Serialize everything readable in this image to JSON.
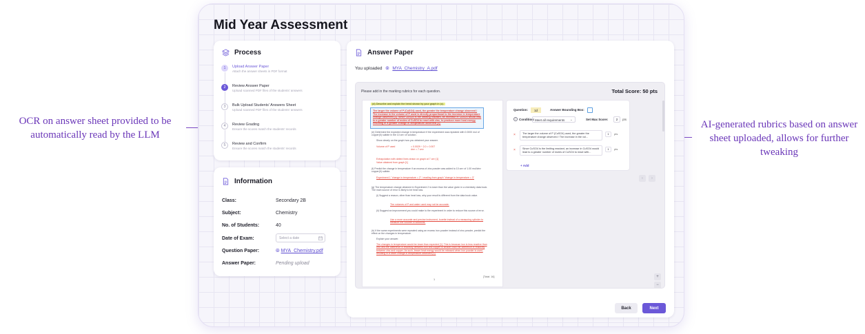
{
  "page_title": "Mid Year Assessment",
  "process": {
    "title": "Process",
    "steps": [
      {
        "num": "1",
        "title": "Upload Answer Paper",
        "subtitle": "Attach the answer sheets in PDF format"
      },
      {
        "num": "2",
        "title": "Review Answer Paper",
        "subtitle": "Upload scanned PDF files of the students' answers"
      },
      {
        "num": "3",
        "title": "Bulk Upload Students' Answers Sheet",
        "subtitle": "Upload scanned PDF files of the students' answers"
      },
      {
        "num": "4",
        "title": "Review Grading",
        "subtitle": "Ensure the scores match the students' records"
      },
      {
        "num": "5",
        "title": "Review and Confirm",
        "subtitle": "Ensure the scores match the students' records"
      }
    ]
  },
  "information": {
    "title": "Information",
    "class_label": "Class:",
    "class_value": "Secondary 2B",
    "subject_label": "Subject:",
    "subject_value": "Chemistry",
    "students_label": "No. of Students:",
    "students_value": "40",
    "date_label": "Date of Exam:",
    "date_placeholder": "Select a date",
    "question_label": "Question Paper:",
    "question_value": "MYA_Chemistry.pdf",
    "answer_label": "Answer Paper:",
    "answer_value": "Pending upload"
  },
  "answer_paper": {
    "title": "Answer Paper",
    "uploaded_prefix": "You uploaded",
    "uploaded_file": "MYA_Chemistry_A.pdf",
    "instruction": "Please add in the marking rubrics for each question.",
    "total_score": "Total Score: 50 pts",
    "paper": {
      "tag": "(d)  Describe and explain the trend shown by your graph in (c).",
      "highlight": "The larger the volume of P (CuSO4) used, the greater the temperature change observed / The increase in the volume of P used is directly proportional to the increase in temperature change observed [1]. Since CuSO4 is the limiting reactant, an increase in CuSO4 would lead to a greater number of moles of CuSO4 to react with zinc, to produce more heat energy, resulting in a greater change in temperature observed [1].",
      "e_text": "(e)  Determine the expected change in temperature if the experiment was repeated with 0.0000 mol of copper(II) sulfate in the 10 cm³ of solution.",
      "e_show": "Show clearly on the graph how you obtained your answer.",
      "e_vol": "Volume of P used",
      "e_calc": "= 0.0029 ÷ 2.0  = 0.007 dm³  = 7 cm³",
      "e_extra": "Extrapolation with dotted lines drawn on graph at 7 cm³ [1]",
      "e_value": "Value obtained from graph [1]",
      "f_text": "(f)  Predict the change in temperature if an excess of zinc powder was added to 10 cm³ of 1.00 mol/dm³ copper(II) sulfate.",
      "f_answer": "Experiment 1 \"change in temperature = 2\" / reading from graph \"change in temperature = 3\"",
      "g_text": "(g)  The temperature change obtained in Experiment 2 is lower than the value given in a chemistry data book. The main source of error is likely to be heat loss.",
      "g_i": "(i)  Suggest a reason, other than heat loss, why your result is different from the data book value.",
      "g_i_ans": "The volumes of P and water used may not be accurate.",
      "g_ii": "(ii)  Suggest an improvement you could make to the experiment in order to reduce this source of error.",
      "g_ii_ans": "Use a more accurate and precise instrument, burette instead of a measuring cylinder to measure the volume of solutions.",
      "h_text": "(h)  If the same experiments were repeated using an excess iron powder instead of zinc powder, predict the effect on the changes in temperature.",
      "h_explain": "Explain your answer.",
      "h_answer": "The changes in temperature would be lower than expected [1]. This is because iron is less reactive than zinc and the difference in reactivity between iron and copper is smaller than the difference in reactivity between zinc and copper. As such, lesser heat energy would be released when iron powder is used, resulting in a lower change in temperature observed [1].",
      "page_num": "1",
      "total_mark": "[Total: 16]"
    },
    "rubric": {
      "question_label": "Question:",
      "question_value": "1d",
      "bbox_label": "Answer Bounding Box:",
      "condition_label": "Condition:",
      "condition_value": "Meet all requirements",
      "max_label": "Set Max Score:",
      "max_value": "2",
      "pts": "pts",
      "criteria": [
        {
          "text": "The larger the volume of P (CuSO4) used, the greater the temperature change observed / The increase in the vol...",
          "score": "1",
          "pts": "pts"
        },
        {
          "text": "Since CuSO4 is the limiting reactant, an increase in CuSO4 would lead to a greater number of moles of CuSO4 to react with...",
          "score": "1",
          "pts": "pts"
        }
      ],
      "add_label": "+ Add"
    },
    "back_label": "Back",
    "next_label": "Next"
  },
  "callouts": {
    "left": "OCR on answer sheet provided to be automatically read by the LLM",
    "right": "AI-generated rubrics based on answer sheet uploaded, allows for further tweaking"
  },
  "colors": {
    "accent": "#6b58d8",
    "callout": "#6a36b8",
    "answer_red": "#e2473c"
  },
  "icons": {
    "process": "layers-icon",
    "information": "document-icon",
    "answer_paper": "document-icon",
    "file": "paperclip-icon",
    "calendar": "calendar-icon",
    "bbox": "bounding-box-icon",
    "remove": "close-icon",
    "info": "info-icon"
  }
}
